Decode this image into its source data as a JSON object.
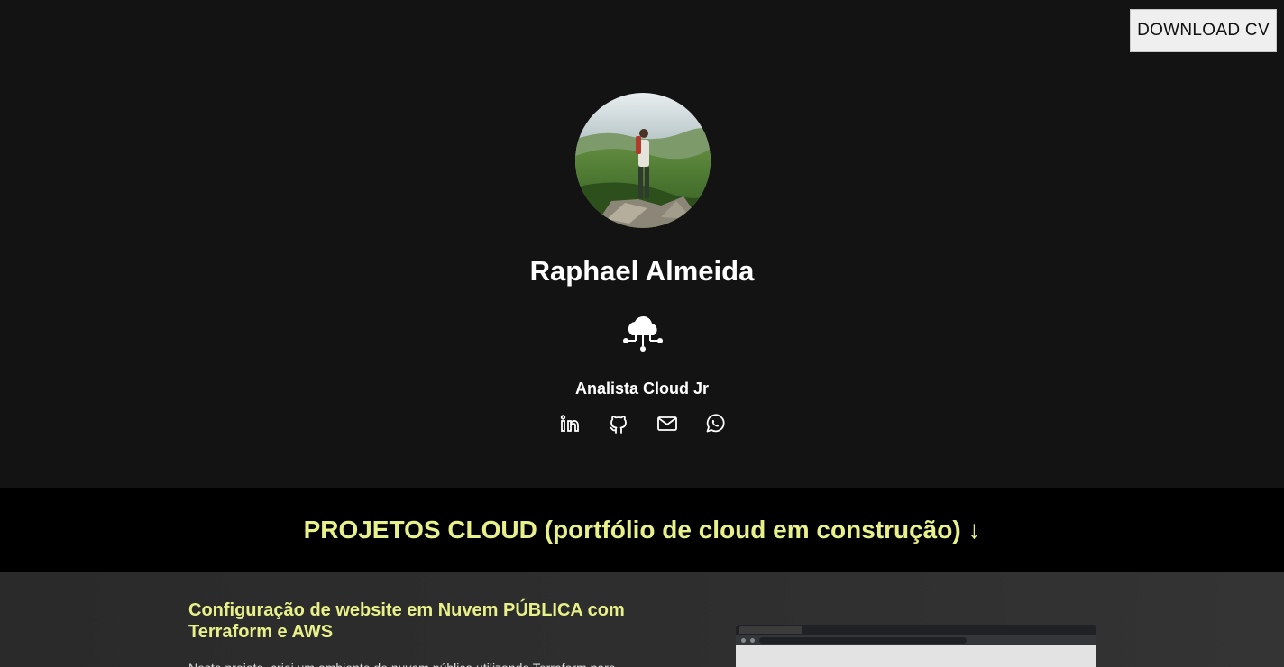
{
  "header": {
    "download_label": "DOWNLOAD CV"
  },
  "profile": {
    "name": "Raphael Almeida",
    "role": "Analista Cloud Jr",
    "avatar_alt": "Profile photo on mountain landscape"
  },
  "socials": [
    {
      "icon": "linkedin-icon"
    },
    {
      "icon": "github-icon"
    },
    {
      "icon": "mail-icon"
    },
    {
      "icon": "whatsapp-icon"
    }
  ],
  "projects": {
    "heading": "PROJETOS CLOUD (portfólio de cloud em construção) ↓",
    "items": [
      {
        "title": "Configuração de website em Nuvem PÚBLICA com Terraform e AWS",
        "description": "Neste projeto, criei um ambiente de nuvem pública utilizando Terraform para"
      }
    ]
  },
  "colors": {
    "accent": "#e8f08a",
    "hero_bg": "#131313",
    "band_bg": "#000000"
  }
}
